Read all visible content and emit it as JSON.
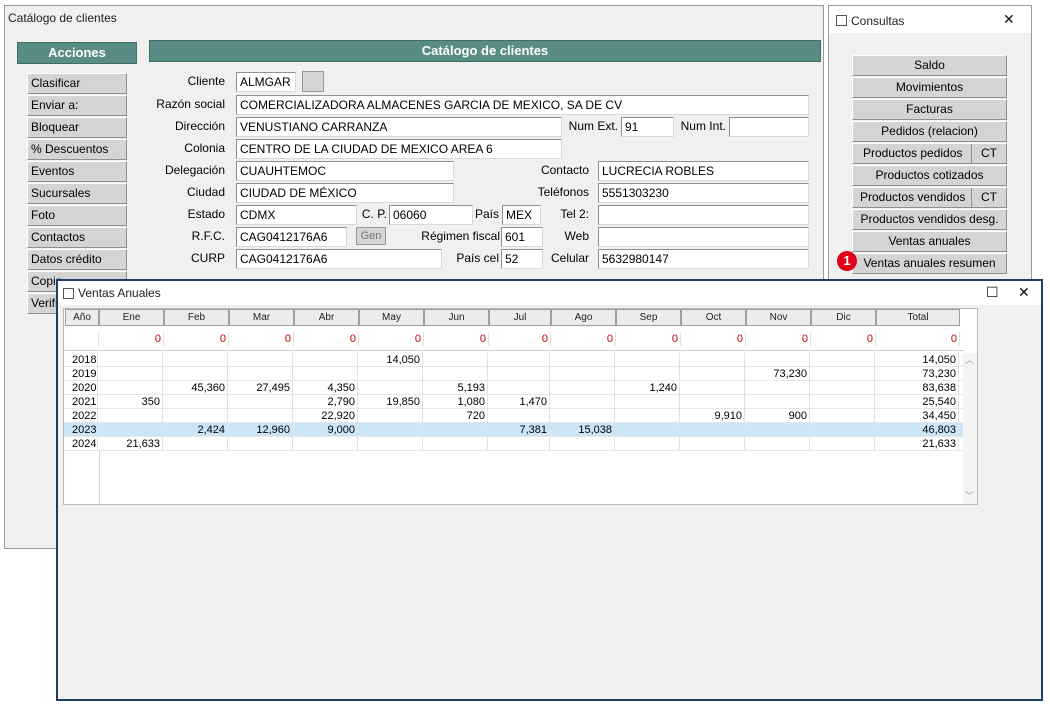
{
  "main_window": {
    "title": "Catálogo de clientes",
    "actions_header": "Acciones",
    "panel_header": "Catálogo de clientes",
    "actions": [
      "Clasificar",
      "Enviar a:",
      "Bloquear",
      "% Descuentos",
      "Eventos",
      "Sucursales",
      "Foto",
      "Contactos",
      "Datos crédito",
      "Copia",
      "Verifi"
    ],
    "labels": {
      "cliente": "Cliente",
      "razon_social": "Razón social",
      "direccion": "Dirección",
      "num_ext": "Num Ext.",
      "num_int": "Num Int.",
      "colonia": "Colonia",
      "delegacion": "Delegación",
      "contacto": "Contacto",
      "ciudad": "Ciudad",
      "telefonos": "Teléfonos",
      "estado": "Estado",
      "cp": "C. P.",
      "pais": "País",
      "tel2": "Tel 2:",
      "rfc": "R.F.C.",
      "gen": "Gen",
      "regimen": "Régimen fiscal",
      "web": "Web",
      "curp": "CURP",
      "pais_cel": "País cel",
      "celular": "Celular"
    },
    "values": {
      "cliente": "ALMGAR",
      "razon_social": "COMERCIALIZADORA ALMACENES GARCIA DE MEXICO, SA DE CV",
      "direccion": "VENUSTIANO CARRANZA",
      "num_ext": "91",
      "num_int": "",
      "colonia": "CENTRO DE LA CIUDAD DE MEXICO AREA 6",
      "delegacion": "CUAUHTEMOC",
      "contacto": "LUCRECIA ROBLES",
      "ciudad": "CIUDAD DE MÉXICO",
      "telefonos": "5551303230",
      "estado": "CDMX",
      "cp": "06060",
      "pais": "MEX",
      "tel2": "",
      "rfc": "CAG0412176A6",
      "regimen": "601",
      "web": "",
      "curp": "CAG0412176A6",
      "pais_cel": "52",
      "celular": "5632980147"
    }
  },
  "consultas_window": {
    "title": "Consultas",
    "close_glyph": "✕",
    "buttons": [
      {
        "label": "Saldo"
      },
      {
        "label": "Movimientos"
      },
      {
        "label": "Facturas"
      },
      {
        "label": "Pedidos (relacion)"
      },
      {
        "label": "Productos pedidos",
        "extra": "CT"
      },
      {
        "label": "Productos cotizados"
      },
      {
        "label": "Productos vendidos",
        "extra": "CT"
      },
      {
        "label": "Productos vendidos desg."
      },
      {
        "label": "Ventas anuales"
      }
    ],
    "highlight_badge": "1",
    "highlight_label": "Ventas anuales resumen"
  },
  "ventas_window": {
    "title": "Ventas Anuales",
    "maximize_glyph": "☐",
    "close_glyph": "✕",
    "columns": [
      "Año",
      "Ene",
      "Feb",
      "Mar",
      "Abr",
      "May",
      "Jun",
      "Jul",
      "Ago",
      "Sep",
      "Oct",
      "Nov",
      "Dic",
      "Total"
    ],
    "totals": [
      "",
      "0",
      "0",
      "0",
      "0",
      "0",
      "0",
      "0",
      "0",
      "0",
      "0",
      "0",
      "0",
      "0"
    ],
    "rows": [
      [
        "2018",
        "",
        "",
        "",
        "",
        "14,050",
        "",
        "",
        "",
        "",
        "",
        "",
        "",
        "14,050"
      ],
      [
        "2019",
        "",
        "",
        "",
        "",
        "",
        "",
        "",
        "",
        "",
        "",
        "73,230",
        "",
        "73,230"
      ],
      [
        "2020",
        "",
        "45,360",
        "27,495",
        "4,350",
        "",
        "5,193",
        "",
        "",
        "1,240",
        "",
        "",
        "",
        "83,638"
      ],
      [
        "2021",
        "350",
        "",
        "",
        "2,790",
        "19,850",
        "1,080",
        "1,470",
        "",
        "",
        "",
        "",
        "",
        "25,540"
      ],
      [
        "2022",
        "",
        "",
        "",
        "22,920",
        "",
        "720",
        "",
        "",
        "",
        "9,910",
        "900",
        "",
        "34,450"
      ],
      [
        "2023",
        "",
        "2,424",
        "12,960",
        "9,000",
        "",
        "",
        "7,381",
        "15,038",
        "",
        "",
        "",
        "",
        "46,803"
      ],
      [
        "2024",
        "21,633",
        "",
        "",
        "",
        "",
        "",
        "",
        "",
        "",
        "",
        "",
        "",
        "21,633"
      ]
    ],
    "selected_row": 5
  }
}
